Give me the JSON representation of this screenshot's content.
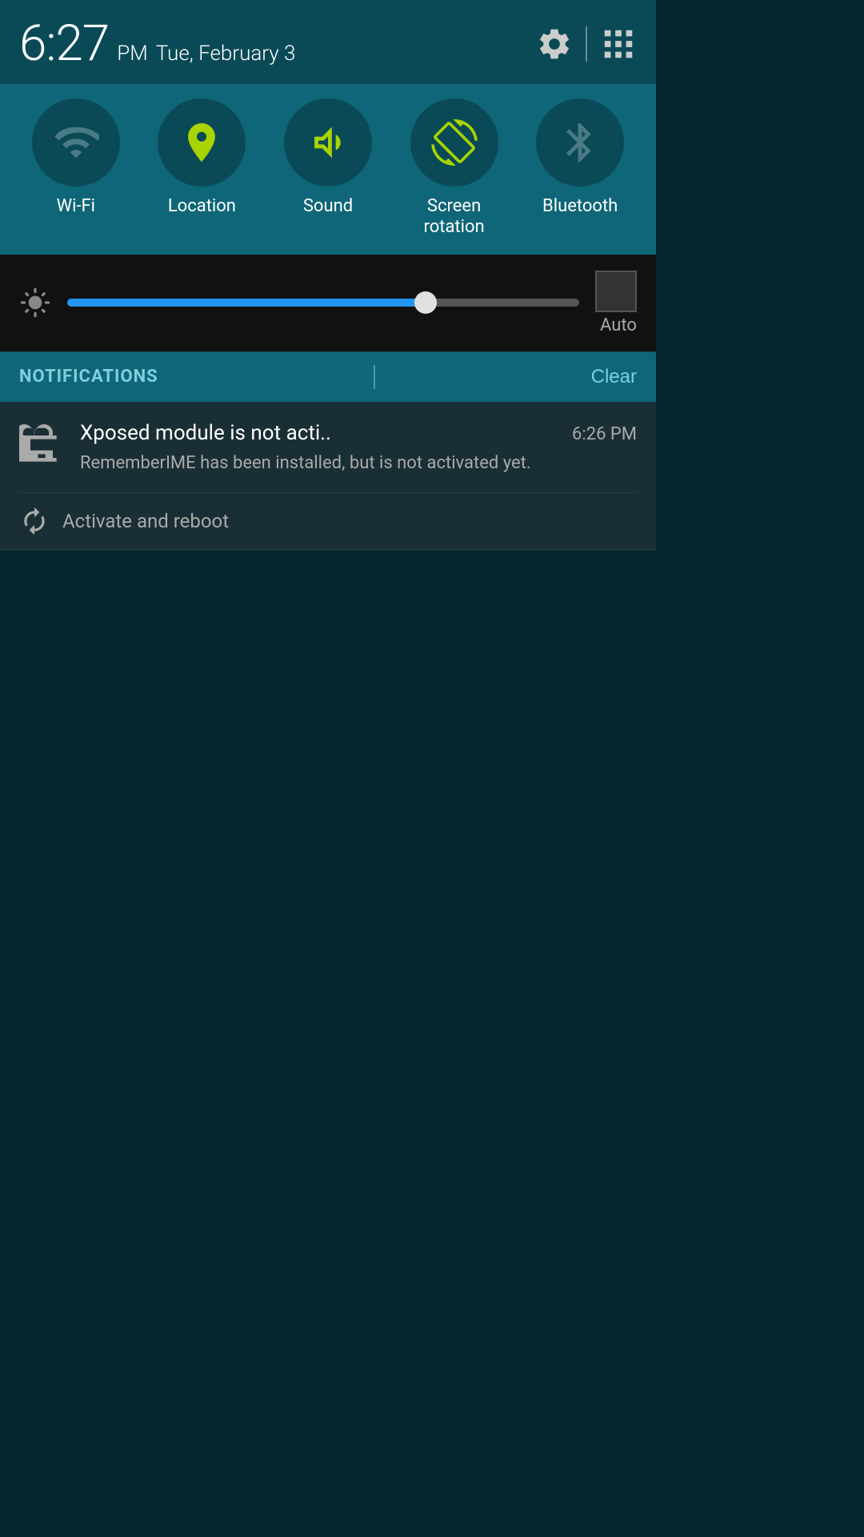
{
  "status_bar": {
    "time": "6:27",
    "ampm": "PM",
    "date": "Tue, February 3"
  },
  "quick_settings": {
    "items": [
      {
        "id": "wifi",
        "label": "Wi-Fi",
        "active": false
      },
      {
        "id": "location",
        "label": "Location",
        "active": true
      },
      {
        "id": "sound",
        "label": "Sound",
        "active": true
      },
      {
        "id": "screen_rotation",
        "label": "Screen\nrotation",
        "active": true
      },
      {
        "id": "bluetooth",
        "label": "Bluetooth",
        "active": false
      }
    ]
  },
  "brightness": {
    "auto_label": "Auto",
    "value": 70
  },
  "notifications": {
    "title": "NOTIFICATIONS",
    "clear_label": "Clear",
    "items": [
      {
        "id": "xposed",
        "title": "Xposed module is not acti..",
        "time": "6:26 PM",
        "body": "RememberIME has been installed, but is not activated yet.",
        "action_label": "Activate and reboot"
      }
    ]
  }
}
